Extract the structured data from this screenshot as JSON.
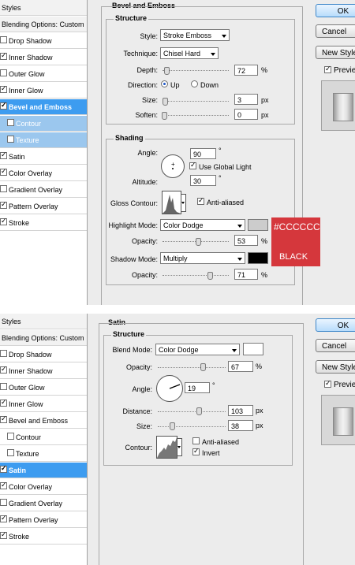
{
  "shot1": {
    "styles": [
      {
        "label": "Styles",
        "checkbox": false,
        "checked": false,
        "kind": "hdr"
      },
      {
        "label": "Blending Options: Custom",
        "checkbox": false,
        "checked": false,
        "kind": "hdr"
      },
      {
        "label": "Drop Shadow",
        "checkbox": true,
        "checked": false,
        "kind": ""
      },
      {
        "label": "Inner Shadow",
        "checkbox": true,
        "checked": true,
        "kind": ""
      },
      {
        "label": "Outer Glow",
        "checkbox": true,
        "checked": false,
        "kind": ""
      },
      {
        "label": "Inner Glow",
        "checkbox": true,
        "checked": true,
        "kind": ""
      },
      {
        "label": "Bevel and Emboss",
        "checkbox": true,
        "checked": true,
        "kind": "sel"
      },
      {
        "label": "Contour",
        "checkbox": true,
        "checked": false,
        "kind": "sub"
      },
      {
        "label": "Texture",
        "checkbox": true,
        "checked": false,
        "kind": "sub"
      },
      {
        "label": "Satin",
        "checkbox": true,
        "checked": true,
        "kind": ""
      },
      {
        "label": "Color Overlay",
        "checkbox": true,
        "checked": true,
        "kind": ""
      },
      {
        "label": "Gradient Overlay",
        "checkbox": true,
        "checked": false,
        "kind": ""
      },
      {
        "label": "Pattern Overlay",
        "checkbox": true,
        "checked": true,
        "kind": ""
      },
      {
        "label": "Stroke",
        "checkbox": true,
        "checked": true,
        "kind": ""
      }
    ],
    "panel_title": "Bevel and Emboss",
    "structure": {
      "title": "Structure",
      "style_label": "Style:",
      "style_value": "Stroke Emboss",
      "technique_label": "Technique:",
      "technique_value": "Chisel Hard",
      "depth_label": "Depth:",
      "depth_value": "72",
      "depth_unit": "%",
      "depth_level": 0.72,
      "direction_label": "Direction:",
      "direction_up": "Up",
      "direction_down": "Down",
      "size_label": "Size:",
      "size_value": "3",
      "size_unit": "px",
      "size_level": 0.03,
      "soften_label": "Soften:",
      "soften_value": "0",
      "soften_unit": "px",
      "soften_level": 0.0
    },
    "shading": {
      "title": "Shading",
      "angle_label": "Angle:",
      "angle_value": "90",
      "angle_unit": "°",
      "global_light": "Use Global Light",
      "altitude_label": "Altitude:",
      "altitude_value": "30",
      "altitude_unit": "°",
      "gloss_label": "Gloss Contour:",
      "anti_aliased": "Anti-aliased",
      "highlight_label": "Highlight Mode:",
      "highlight_value": "Color Dodge",
      "highlight_color": "#cccccc",
      "opacity1_label": "Opacity:",
      "opacity1_value": "53",
      "opacity1_unit": "%",
      "opacity1_level": 0.53,
      "shadow_label": "Shadow Mode:",
      "shadow_value": "Multiply",
      "shadow_color": "#000000",
      "opacity2_label": "Opacity:",
      "opacity2_value": "71",
      "opacity2_unit": "%",
      "opacity2_level": 0.71
    },
    "annotation": {
      "color_code": "#CCCCCC",
      "color_name": "BLACK",
      "bg": "#d5373c"
    },
    "buttons": {
      "ok": "OK",
      "cancel": "Cancel",
      "new_style": "New Style...",
      "preview": "Preview"
    }
  },
  "shot2": {
    "styles": [
      {
        "label": "Styles",
        "checkbox": false,
        "checked": false,
        "kind": "hdr"
      },
      {
        "label": "Blending Options: Custom",
        "checkbox": false,
        "checked": false,
        "kind": "hdr"
      },
      {
        "label": "Drop Shadow",
        "checkbox": true,
        "checked": false,
        "kind": ""
      },
      {
        "label": "Inner Shadow",
        "checkbox": true,
        "checked": true,
        "kind": ""
      },
      {
        "label": "Outer Glow",
        "checkbox": true,
        "checked": false,
        "kind": ""
      },
      {
        "label": "Inner Glow",
        "checkbox": true,
        "checked": true,
        "kind": ""
      },
      {
        "label": "Bevel and Emboss",
        "checkbox": true,
        "checked": true,
        "kind": ""
      },
      {
        "label": "Contour",
        "checkbox": true,
        "checked": false,
        "kind": "sub2"
      },
      {
        "label": "Texture",
        "checkbox": true,
        "checked": false,
        "kind": "sub2"
      },
      {
        "label": "Satin",
        "checkbox": true,
        "checked": true,
        "kind": "sel"
      },
      {
        "label": "Color Overlay",
        "checkbox": true,
        "checked": true,
        "kind": ""
      },
      {
        "label": "Gradient Overlay",
        "checkbox": true,
        "checked": false,
        "kind": ""
      },
      {
        "label": "Pattern Overlay",
        "checkbox": true,
        "checked": true,
        "kind": ""
      },
      {
        "label": "Stroke",
        "checkbox": true,
        "checked": true,
        "kind": ""
      }
    ],
    "panel_title": "Satin",
    "structure": {
      "title": "Structure",
      "blend_label": "Blend Mode:",
      "blend_value": "Color Dodge",
      "blend_color": "#ffffff",
      "opacity_label": "Opacity:",
      "opacity_value": "67",
      "opacity_unit": "%",
      "opacity_level": 0.67,
      "angle_label": "Angle:",
      "angle_value": "19",
      "angle_unit": "°",
      "distance_label": "Distance:",
      "distance_value": "103",
      "distance_unit": "px",
      "distance_level": 0.41,
      "size_label": "Size:",
      "size_value": "38",
      "size_unit": "px",
      "size_level": 0.15,
      "contour_label": "Contour:",
      "anti_aliased": "Anti-aliased",
      "invert": "Invert"
    },
    "buttons": {
      "ok": "OK",
      "cancel": "Cancel",
      "new_style": "New Style...",
      "preview": "Preview"
    }
  }
}
